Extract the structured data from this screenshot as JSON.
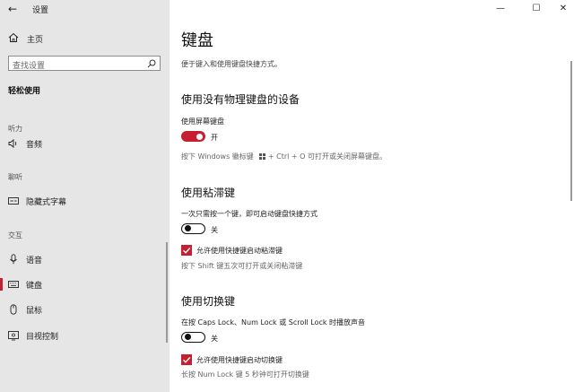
{
  "window": {
    "title": "设置",
    "controls": {
      "minimize": "—",
      "maximize": "☐",
      "close": "✕"
    }
  },
  "sidebar": {
    "back_icon": "←",
    "home_label": "主页",
    "search_placeholder": "查找设置",
    "category": "轻松使用",
    "groups": [
      {
        "header": "听力",
        "items": [
          {
            "label": "音频",
            "icon": "speaker-icon"
          }
        ]
      },
      {
        "header": "聊听",
        "items": [
          {
            "label": "隐藏式字幕",
            "icon": "captions-icon"
          }
        ]
      },
      {
        "header": "交互",
        "items": [
          {
            "label": "语音",
            "icon": "microphone-icon"
          },
          {
            "label": "键盘",
            "icon": "keyboard-icon",
            "selected": true
          },
          {
            "label": "鼠标",
            "icon": "mouse-icon"
          },
          {
            "label": "目视控制",
            "icon": "eye-control-icon"
          }
        ]
      }
    ]
  },
  "main": {
    "title": "键盘",
    "description": "便于键入和使用键盘快捷方式。",
    "sections": [
      {
        "title": "使用没有物理键盘的设备",
        "field_label": "使用屏幕键盘",
        "toggle_state": "开",
        "toggle_on": true,
        "hint_before": "按下 Windows 徽标键",
        "hint_after": " + Ctrl + O 可打开或关闭屏幕键盘。"
      },
      {
        "title": "使用粘滞键",
        "field_label": "一次只需按一个键，即可启动键盘快捷方式",
        "toggle_state": "关",
        "toggle_on": false,
        "checkbox_label": "允许使用快捷键启动粘滞键",
        "checkbox_checked": true,
        "hint": "按下 Shift 键五次可打开或关闭粘滞键"
      },
      {
        "title": "使用切换键",
        "field_label": "在按 Caps Lock、Num Lock 或 Scroll Lock 时播放声音",
        "toggle_state": "关",
        "toggle_on": false,
        "checkbox_label": "允许使用快捷键启动切换键",
        "checkbox_checked": true,
        "hint": "长按 Num Lock 键 5 秒钟可打开切换键"
      }
    ]
  },
  "colors": {
    "accent": "#c51f32",
    "sidebar_bg": "#e6e6e6",
    "main_bg": "#ffffff"
  }
}
